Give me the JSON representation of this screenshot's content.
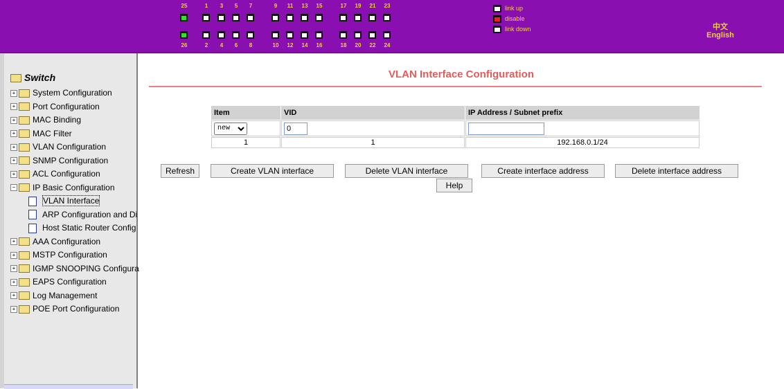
{
  "header": {
    "port_numbers_top": [
      "25",
      "1",
      "3",
      "5",
      "7",
      "9",
      "11",
      "13",
      "15",
      "17",
      "19",
      "21",
      "23"
    ],
    "port_numbers_bottom": [
      "26",
      "2",
      "4",
      "6",
      "8",
      "10",
      "12",
      "14",
      "16",
      "18",
      "20",
      "22",
      "24"
    ],
    "legend": {
      "link_up": "link up",
      "disable": "disable",
      "link_down": "link down"
    },
    "lang_chinese": "中文",
    "lang_english": "English"
  },
  "sidebar": {
    "root": "Switch",
    "items": [
      "System Configuration",
      "Port Configuration",
      "MAC Binding",
      "MAC Filter",
      "VLAN Configuration",
      "SNMP Configuration",
      "ACL Configuration",
      "IP Basic Configuration",
      "VLAN Interface",
      "ARP Configuration and Di",
      "Host Static Router Config",
      "AAA Configuration",
      "MSTP Configuration",
      "IGMP SNOOPING Configura",
      "EAPS Configuration",
      "Log Management",
      "POE Port Configuration"
    ]
  },
  "main": {
    "title": "VLAN Interface Configuration",
    "table": {
      "headers": [
        "Item",
        "VID",
        "IP Address / Subnet prefix"
      ],
      "item_select": "new",
      "vid_value": "0",
      "ip_value": "",
      "row": [
        "1",
        "1",
        "192.168.0.1/24"
      ]
    },
    "buttons": {
      "refresh": "Refresh",
      "create_vlan": "Create VLAN interface",
      "delete_vlan": "Delete VLAN interface",
      "create_addr": "Create interface address",
      "delete_addr": "Delete interface address",
      "help": "Help"
    }
  }
}
